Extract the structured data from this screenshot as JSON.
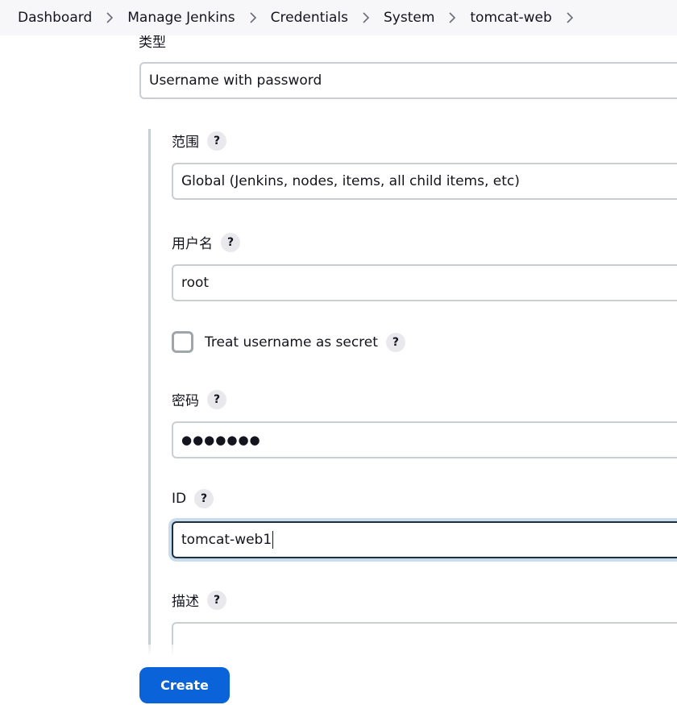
{
  "breadcrumb": {
    "items": [
      "Dashboard",
      "Manage Jenkins",
      "Credentials",
      "System",
      "tomcat-web"
    ],
    "separator_icon": "chevron-right-icon"
  },
  "form": {
    "kind": {
      "label": "类型",
      "value": "Username with password"
    },
    "scope": {
      "label": "范围",
      "value": "Global (Jenkins, nodes, items, all child items, etc)"
    },
    "username": {
      "label": "用户名",
      "value": "root"
    },
    "username_secret": {
      "label": "Treat username as secret",
      "checked": false
    },
    "password": {
      "label": "密码",
      "value": "●●●●●●●"
    },
    "id": {
      "label": "ID",
      "value": "tomcat-web1"
    },
    "description": {
      "label": "描述",
      "value": ""
    },
    "help_glyph": "?"
  },
  "actions": {
    "create_label": "Create"
  },
  "colors": {
    "primary_button": "#0b63d9",
    "focus_ring": "#c9dcec",
    "border": "#c8ced3",
    "breadcrumb_bg": "#f7f7f9"
  }
}
